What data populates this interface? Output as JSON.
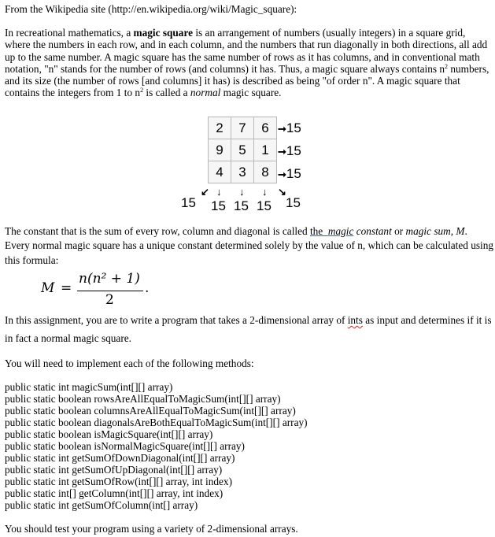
{
  "source_line": "From the Wikipedia site (http://en.wikipedia.org/wiki/Magic_square):",
  "intro": {
    "part1": "In recreational mathematics, a ",
    "bold": "magic square",
    "part2": " is an arrangement of numbers (usually integers) in a square grid, where the numbers in each row, and in each column, and the numbers that run diagonally in both directions, all add up to the same number. A magic square has the same number of rows as it has columns, and in conventional math notation, \"n\" stands for the number of rows (and columns) it has. Thus, a magic square always contains n",
    "sup1": "2",
    "part3": " numbers, and its size (the number of rows [and columns] it has) is described as being \"of order n\".  A magic square that contains the integers from 1 to n",
    "sup2": "2",
    "part4": " is called a ",
    "italic": "normal",
    "part5": " magic square."
  },
  "magic_square": {
    "rows": [
      [
        2,
        7,
        6
      ],
      [
        9,
        5,
        1
      ],
      [
        4,
        3,
        8
      ]
    ],
    "row_sums": [
      "15",
      "15",
      "15"
    ],
    "column_sums": [
      "15",
      "15",
      "15"
    ],
    "diagonal_sums": [
      "15",
      "15"
    ],
    "arrow_right": "➞",
    "arrow_down": "↓",
    "arrow_down_left": "↙",
    "arrow_down_right": "↘"
  },
  "constant_para": {
    "part1": "The constant that is the sum of every row, column and diagonal is called ",
    "link_text": "the  magic",
    "part2": " constant",
    "part3": " or ",
    "italic2": "magic sum",
    "part4": ", ",
    "italic3": "M",
    "part5": ".",
    "line2": "Every normal magic square has a unique constant determined solely by the value of n, which can be calculated using",
    "line3": "this formula:"
  },
  "formula": {
    "lhs": "M",
    "eq": "=",
    "numerator": "n(n² + 1)",
    "denominator": "2",
    "trail": "."
  },
  "assignment": {
    "part1": "In this assignment, you are to write a program that takes a 2-dimensional array of ",
    "ints": "ints",
    "part2": " as input and determines if it is",
    "line2": "in fact a normal magic square."
  },
  "methods_intro": "You will need to implement each of the following methods:",
  "methods": [
    "public static int magicSum(int[][] array)",
    "public static boolean rowsAreAllEqualToMagicSum(int[][] array)",
    "public static boolean columnsAreAllEqualToMagicSum(int[][] array)",
    "public static boolean diagonalsAreBothEqualToMagicSum(int[][] array)",
    "public static boolean isMagicSquare(int[][] array)",
    "public static boolean isNormalMagicSquare(int[][] array)",
    "public static int getSumOfDownDiagonal(int[][] array)",
    "public static int getSumOfUpDiagonal(int[][] array)",
    "public static int  getSumOfRow(int[][] array, int index)",
    "public static int[] getColumn(int[][] array, int index)",
    "public static int getSumOfColumn(int[] array)"
  ],
  "closing": "You should test your program using a variety of 2-dimensional arrays."
}
